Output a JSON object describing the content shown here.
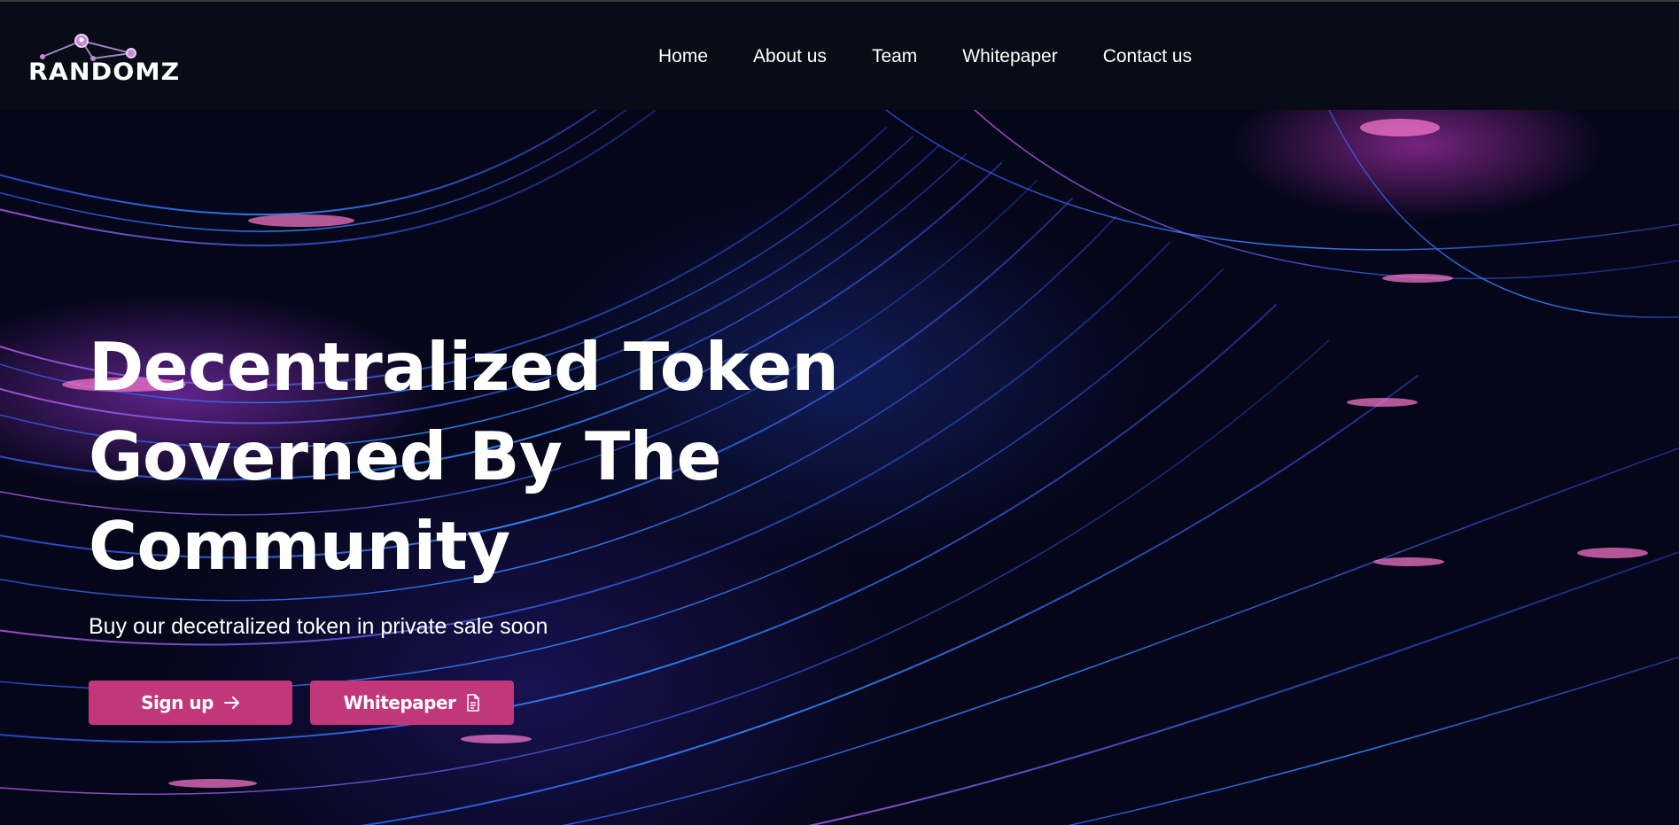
{
  "brand": {
    "logo_text": "RANDOMZ",
    "logo_icon": "network-nodes-icon"
  },
  "nav": {
    "items": [
      {
        "label": "Home"
      },
      {
        "label": "About us"
      },
      {
        "label": "Team"
      },
      {
        "label": "Whitepaper"
      },
      {
        "label": "Contact us"
      }
    ]
  },
  "hero": {
    "title_line1": "Decentralized Token",
    "title_line2": "Governed By The",
    "title_line3": "Community",
    "subtitle": "Buy our decetralized token in private sale soon",
    "primary_button": {
      "label": "Sign up",
      "icon": "arrow-right-icon"
    },
    "secondary_button": {
      "label": "Whitepaper",
      "icon": "document-icon"
    }
  },
  "colors": {
    "header_bg": "#090b16",
    "accent": "#c2367a",
    "text": "#ffffff"
  }
}
